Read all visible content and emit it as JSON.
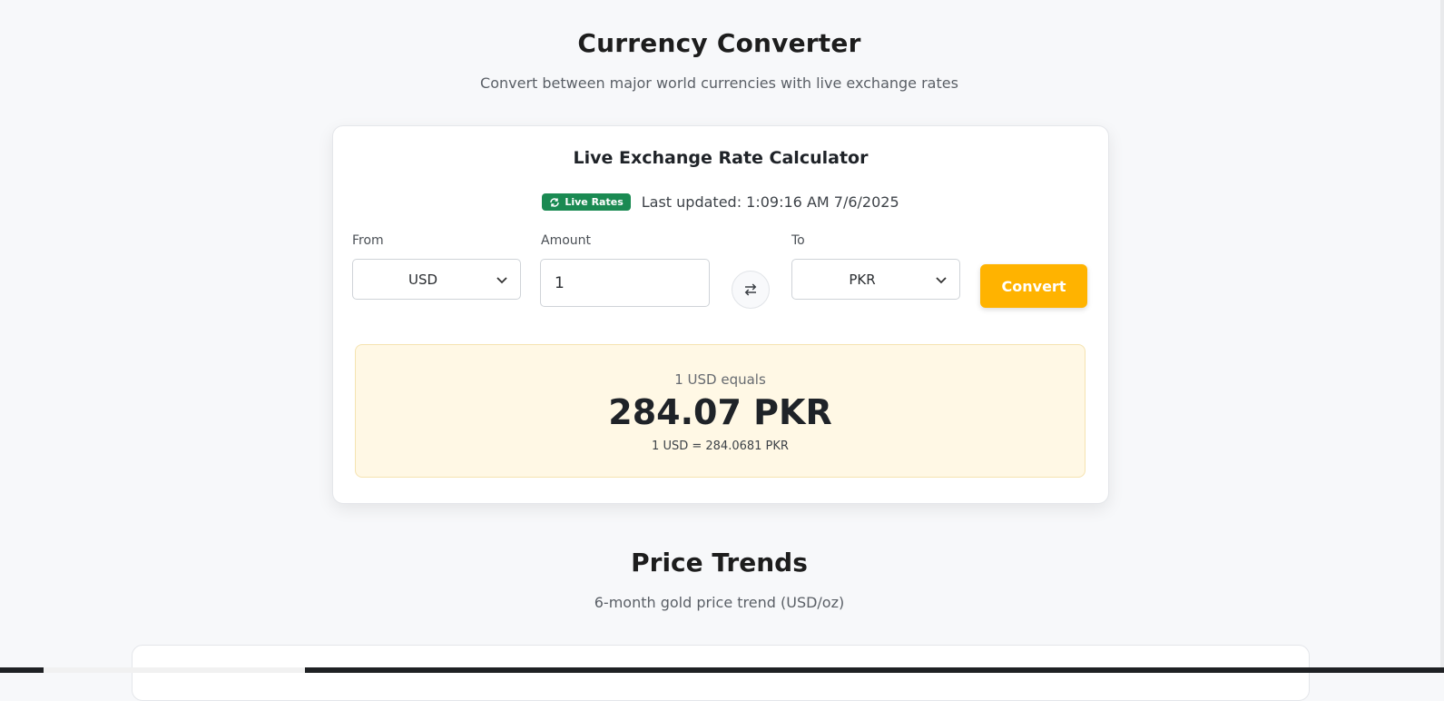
{
  "header": {
    "title": "Currency Converter",
    "subtitle": "Convert between major world currencies with live exchange rates"
  },
  "calculator": {
    "title": "Live Exchange Rate Calculator",
    "badge_label": "Live Rates",
    "last_updated": "Last updated: 1:09:16 AM 7/6/2025",
    "from_label": "From",
    "from_value": "USD",
    "amount_label": "Amount",
    "amount_value": "1",
    "to_label": "To",
    "to_value": "PKR",
    "convert_label": "Convert",
    "result_intro": "1 USD equals",
    "result_value": "284.07 PKR",
    "result_rate": "1 USD = 284.0681 PKR"
  },
  "trends": {
    "title": "Price Trends",
    "subtitle": "6-month gold price trend (USD/oz)"
  },
  "colors": {
    "accent": "#ffb300",
    "live_badge": "#1a8a52",
    "result_bg": "#fff8e5"
  },
  "icons": {
    "badge": "refresh-icon",
    "swap": "swap-arrows-icon",
    "dropdown": "chevron-down-icon"
  }
}
